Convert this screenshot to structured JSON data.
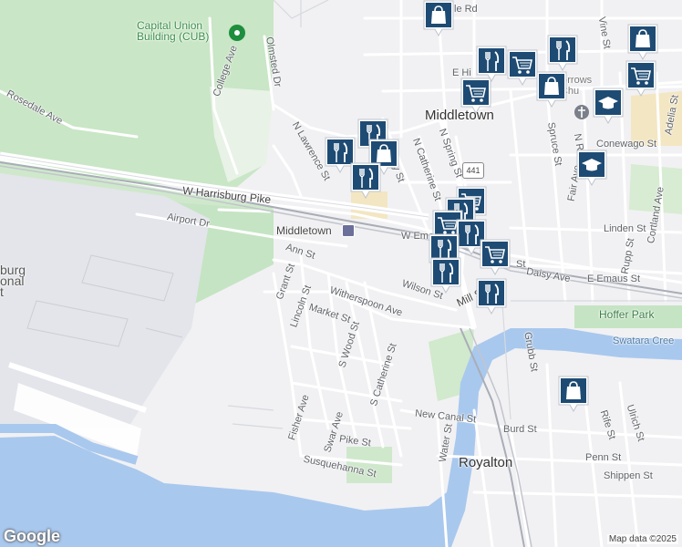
{
  "places": {
    "capital_union": "Capital Union\nBuilding (CUB)",
    "middletown_town": "Middletown",
    "middletown_station": "Middletown",
    "royalton": "Royalton",
    "hoffer_park": "Hoffer Park",
    "swatara_creek": "Swatara Cree",
    "seven_sorrows": "ven Sorrows\nBVM Chu",
    "airport_partial": "burg\nonal\nt"
  },
  "streets": {
    "rosedale": "Rosedale Ave",
    "college": "College Ave",
    "olmsted": "Olmsted Dr",
    "w_harrisburg": "W Harrisburg Pike",
    "airport_dr": "Airport Dr",
    "n_lawrence": "N Lawrence St",
    "n_catherine": "N Catherine St",
    "n_spring": "N Spring St",
    "ann": "Ann St",
    "grant": "Grant St",
    "lincoln": "Lincoln St",
    "witherspoon": "Witherspoon Ave",
    "market": "Market St",
    "s_wood": "S Wood St",
    "s_catherine": "S Catherine St",
    "fisher": "Fisher Ave",
    "swar": "Swar Ave",
    "pike": "Pike St",
    "susquehanna": "Susquehanna St",
    "new_canal": "New Canal St",
    "water": "Water St",
    "burd": "Burd St",
    "wilson": "Wilson St",
    "mill": "Mill St",
    "w_emaus": "W Ema",
    "daisy": "Daisy Ave",
    "e_emaus": "E Emaus St",
    "linden": "Linden St",
    "cortland": "Cortland Ave",
    "rupp": "Rupp St",
    "fair": "Fair Ave",
    "spruce": "Spruce St",
    "vine": "Vine St",
    "adelia": "Adelia St",
    "conewago": "Conewago St",
    "n_r": "N R",
    "grubb": "Grubb St",
    "rife": "Rife St",
    "ulrich": "Ulrich St",
    "penn": "Penn St",
    "shippen": "Shippen St",
    "e_hi": "E Hi",
    "le_rd": "le Rd",
    "st_frag": "St",
    "sley": "sley St"
  },
  "route_shield": "441",
  "google_logo": "Google",
  "attribution": "Map data ©2025",
  "colors": {
    "water": "#a9c8ee",
    "park": "#c8e6c9",
    "pin": "#1e4b73",
    "road": "#ffffff",
    "land": "#f1f1f3"
  },
  "markers": [
    {
      "icon": "shopping-bag-icon",
      "kind": "store"
    },
    {
      "icon": "fork-knife-icon",
      "kind": "restaurant"
    },
    {
      "icon": "shopping-cart-icon",
      "kind": "grocery"
    },
    {
      "icon": "fork-knife-icon",
      "kind": "restaurant"
    },
    {
      "icon": "shopping-bag-icon",
      "kind": "store"
    },
    {
      "icon": "shopping-cart-icon",
      "kind": "grocery"
    },
    {
      "icon": "shopping-cart-icon",
      "kind": "grocery"
    },
    {
      "icon": "shopping-bag-icon",
      "kind": "store"
    },
    {
      "icon": "school-icon",
      "kind": "school"
    },
    {
      "icon": "school-icon",
      "kind": "school"
    },
    {
      "icon": "fork-knife-icon",
      "kind": "restaurant"
    },
    {
      "icon": "fork-knife-icon",
      "kind": "restaurant"
    },
    {
      "icon": "shopping-bag-icon",
      "kind": "store"
    },
    {
      "icon": "fork-knife-icon",
      "kind": "restaurant"
    },
    {
      "icon": "shopping-cart-icon",
      "kind": "grocery"
    },
    {
      "icon": "fork-knife-icon",
      "kind": "restaurant"
    },
    {
      "icon": "shopping-cart-icon",
      "kind": "grocery"
    },
    {
      "icon": "fork-knife-icon",
      "kind": "restaurant"
    },
    {
      "icon": "fork-knife-icon",
      "kind": "restaurant"
    },
    {
      "icon": "shopping-cart-icon",
      "kind": "grocery"
    },
    {
      "icon": "fork-knife-icon",
      "kind": "restaurant"
    },
    {
      "icon": "fork-knife-icon",
      "kind": "restaurant"
    },
    {
      "icon": "shopping-bag-icon",
      "kind": "store"
    }
  ]
}
